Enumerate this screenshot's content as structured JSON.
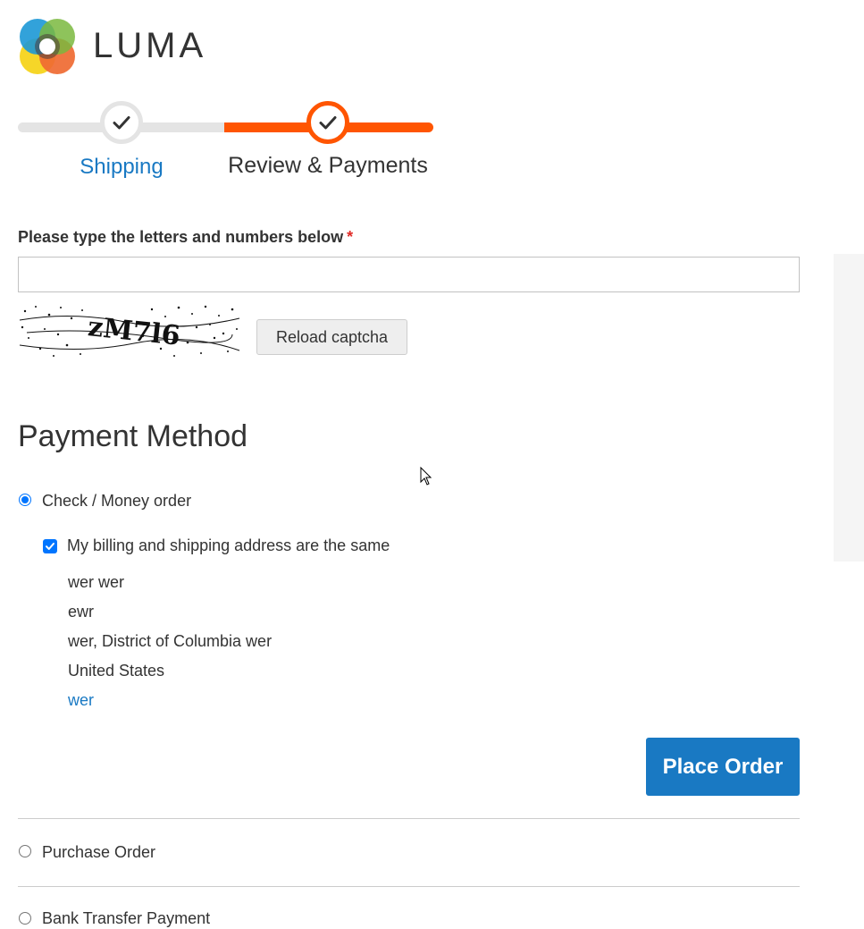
{
  "brand": {
    "name": "LUMA"
  },
  "progress": {
    "steps": [
      {
        "label": "Shipping",
        "state": "complete"
      },
      {
        "label": "Review & Payments",
        "state": "active"
      }
    ]
  },
  "captcha": {
    "label": "Please type the letters and numbers below",
    "required_marker": "*",
    "input_value": "",
    "image_text": "zM7l6",
    "reload_label": "Reload captcha"
  },
  "payment": {
    "title": "Payment Method",
    "methods": [
      {
        "label": "Check / Money order",
        "selected": true
      },
      {
        "label": "Purchase Order",
        "selected": false
      },
      {
        "label": "Bank Transfer Payment",
        "selected": false
      }
    ],
    "same_address_label": "My billing and shipping address are the same",
    "same_address_checked": true,
    "address_lines": [
      "wer wer",
      "ewr",
      "wer, District of Columbia wer",
      "United States",
      "wer"
    ],
    "place_order_label": "Place Order"
  },
  "colors": {
    "accent_orange": "#ff5501",
    "primary_blue": "#1979c3",
    "required_red": "#e02b27"
  }
}
